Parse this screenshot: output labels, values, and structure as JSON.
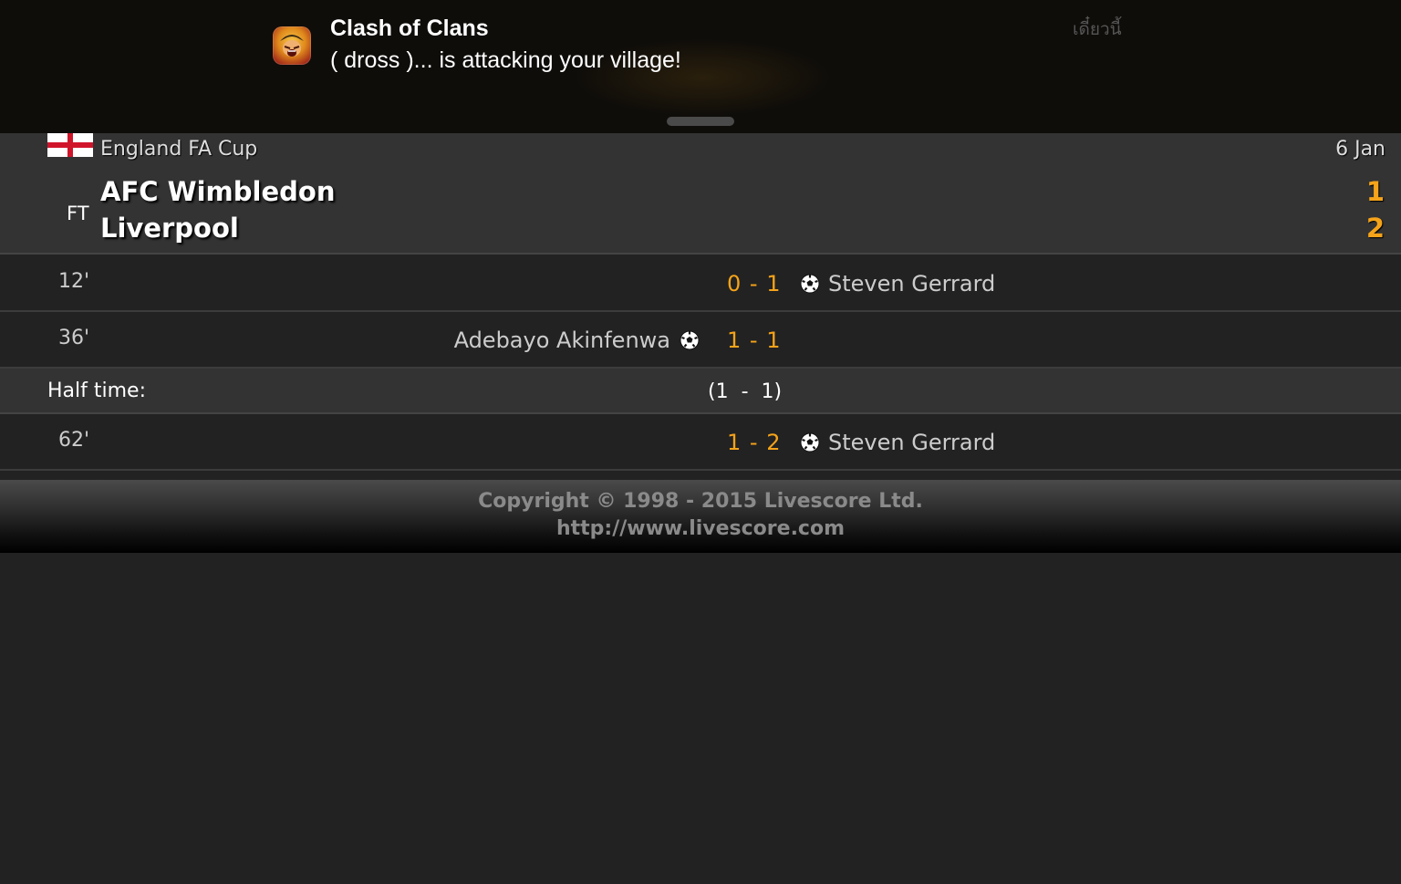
{
  "notification": {
    "app_icon": "clash-of-clans-app-icon",
    "title": "Clash of Clans",
    "message": "( dross )... is attacking your village!",
    "time": "เดี๋ยวนี้"
  },
  "match": {
    "flag": "england-flag-icon",
    "competition": "England FA Cup",
    "date": "6 Jan",
    "status": "FT",
    "home_team": "AFC Wimbledon",
    "away_team": "Liverpool",
    "home_score": "1",
    "away_score": "2"
  },
  "events": [
    {
      "minute": "12'",
      "score": "0 - 1",
      "player_home": "",
      "player_away": "Steven Gerrard",
      "icon": "soccer-ball-icon"
    },
    {
      "minute": "36'",
      "score": "1 - 1",
      "player_home": "Adebayo Akinfenwa",
      "player_away": "",
      "icon": "soccer-ball-icon"
    },
    {
      "minute": "62'",
      "score": "1 - 2",
      "player_home": "",
      "player_away": "Steven Gerrard",
      "icon": "soccer-ball-icon"
    }
  ],
  "halftime": {
    "label": "Half time:",
    "score": "(1  -  1)"
  },
  "footer": {
    "copyright": "Copyright © 1998 - 2015 Livescore Ltd.",
    "url": "http://www.livescore.com"
  },
  "colors": {
    "score_accent": "#f5a31a",
    "background": "#222222",
    "header_background": "#333333"
  }
}
